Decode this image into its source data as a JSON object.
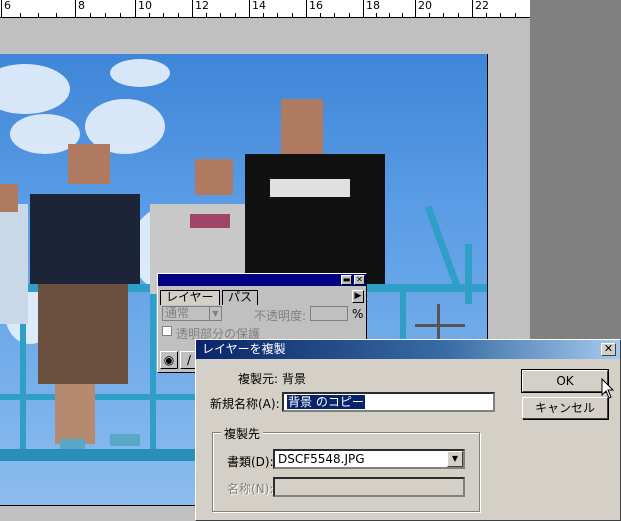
{
  "ruler": {
    "numbers": [
      "6",
      "8",
      "10",
      "12",
      "14",
      "16",
      "18",
      "20",
      "22"
    ]
  },
  "layers_palette": {
    "tab_layers": "レイヤー",
    "tab_paths": "パス",
    "blend_mode": "通常",
    "opacity_label": "不透明度:",
    "opacity_unit": "%",
    "preserve_transparency_label": "透明部分の保護"
  },
  "dialog": {
    "title": "レイヤーを複製",
    "source_label": "複製元:",
    "source_value": "背景",
    "new_name_label": "新規名称(A):",
    "new_name_value": "背景 のコピー",
    "destination_group": "複製先",
    "document_label": "書類(D):",
    "document_value": "DSCF5548.JPG",
    "name_label": "名称(N):",
    "name_value": "",
    "ok_label": "OK",
    "cancel_label": "キャンセル"
  },
  "colors": {
    "titlebar_active": "#0a246a",
    "selection": "#0a246a",
    "palette_title": "#000080"
  }
}
